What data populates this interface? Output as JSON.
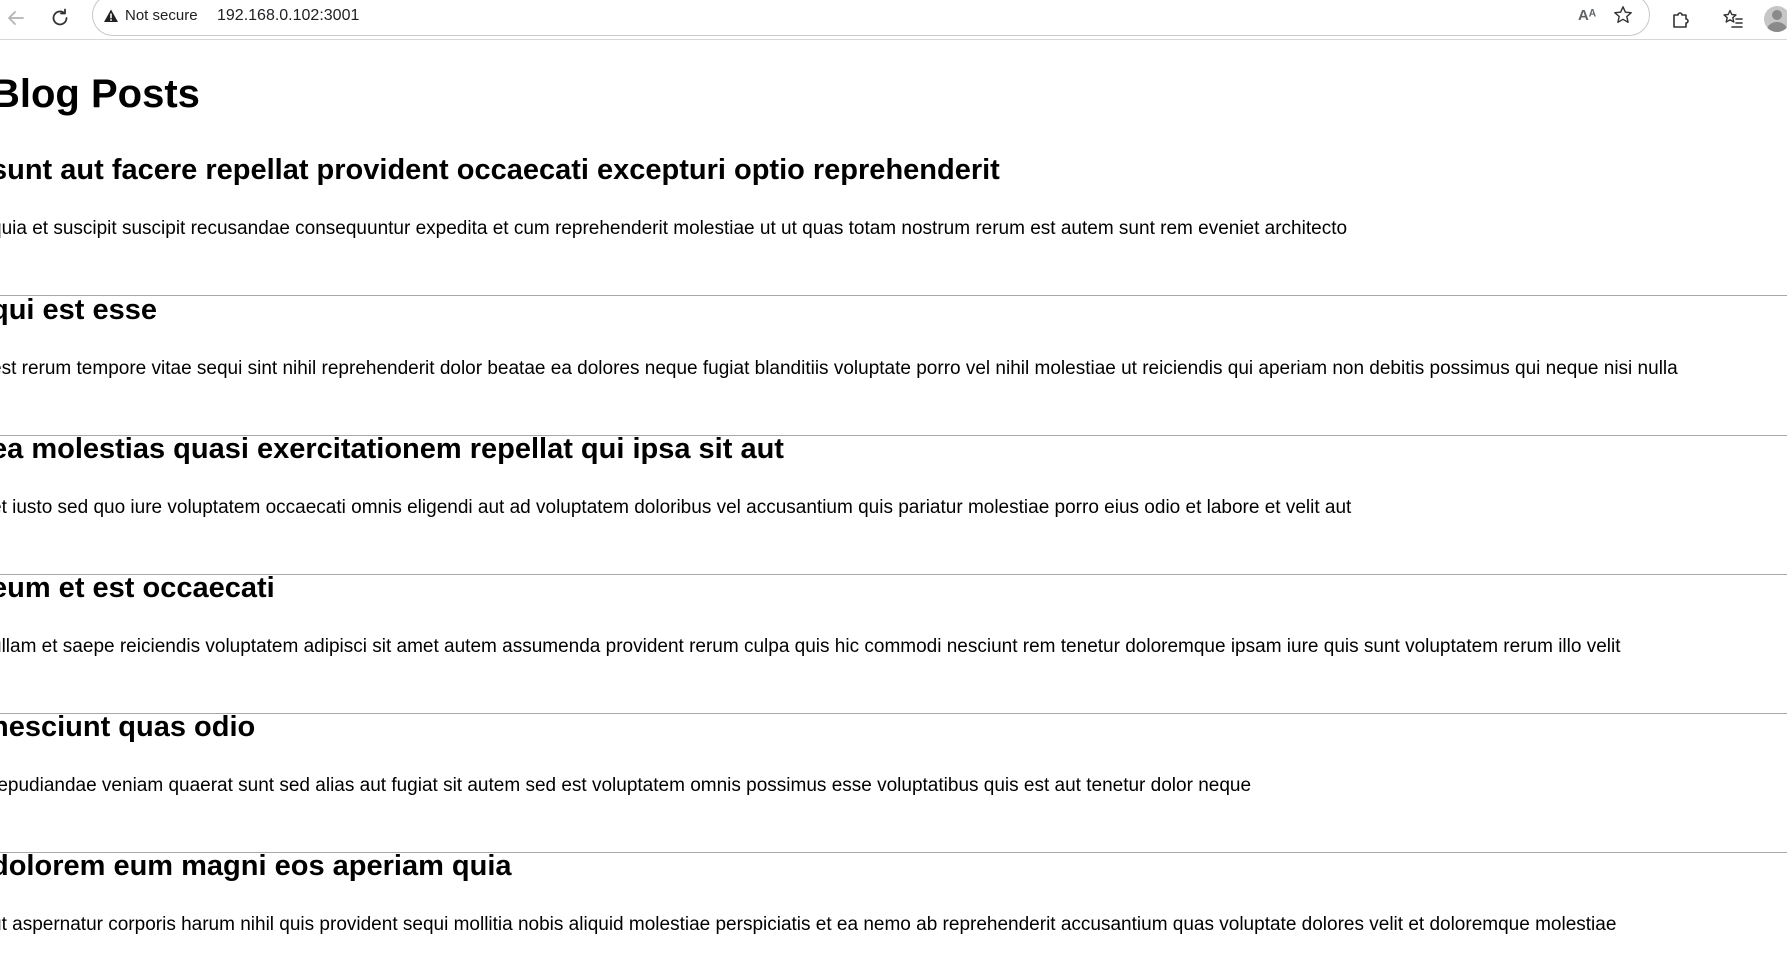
{
  "browser": {
    "security_label": "Not secure",
    "url": "192.168.0.102:3001",
    "read_aloud_label": "Aᴬ"
  },
  "page": {
    "heading": "Blog Posts",
    "posts": [
      {
        "title": "sunt aut facere repellat provident occaecati excepturi optio reprehenderit",
        "body": "quia et suscipit suscipit recusandae consequuntur expedita et cum reprehenderit molestiae ut ut quas totam nostrum rerum est autem sunt rem eveniet architecto"
      },
      {
        "title": "qui est esse",
        "body": "est rerum tempore vitae sequi sint nihil reprehenderit dolor beatae ea dolores neque fugiat blanditiis voluptate porro vel nihil molestiae ut reiciendis qui aperiam non debitis possimus qui neque nisi nulla"
      },
      {
        "title": "ea molestias quasi exercitationem repellat qui ipsa sit aut",
        "body": "et iusto sed quo iure voluptatem occaecati omnis eligendi aut ad voluptatem doloribus vel accusantium quis pariatur molestiae porro eius odio et labore et velit aut"
      },
      {
        "title": "eum et est occaecati",
        "body": "ullam et saepe reiciendis voluptatem adipisci sit amet autem assumenda provident rerum culpa quis hic commodi nesciunt rem tenetur doloremque ipsam iure quis sunt voluptatem rerum illo velit"
      },
      {
        "title": "nesciunt quas odio",
        "body": "repudiandae veniam quaerat sunt sed alias aut fugiat sit autem sed est voluptatem omnis possimus esse voluptatibus quis est aut tenetur dolor neque"
      },
      {
        "title": "dolorem eum magni eos aperiam quia",
        "body": "ut aspernatur corporis harum nihil quis provident sequi mollitia nobis aliquid molestiae perspiciatis et ea nemo ab reprehenderit accusantium quas voluptate dolores velit et doloremque molestiae"
      }
    ]
  }
}
